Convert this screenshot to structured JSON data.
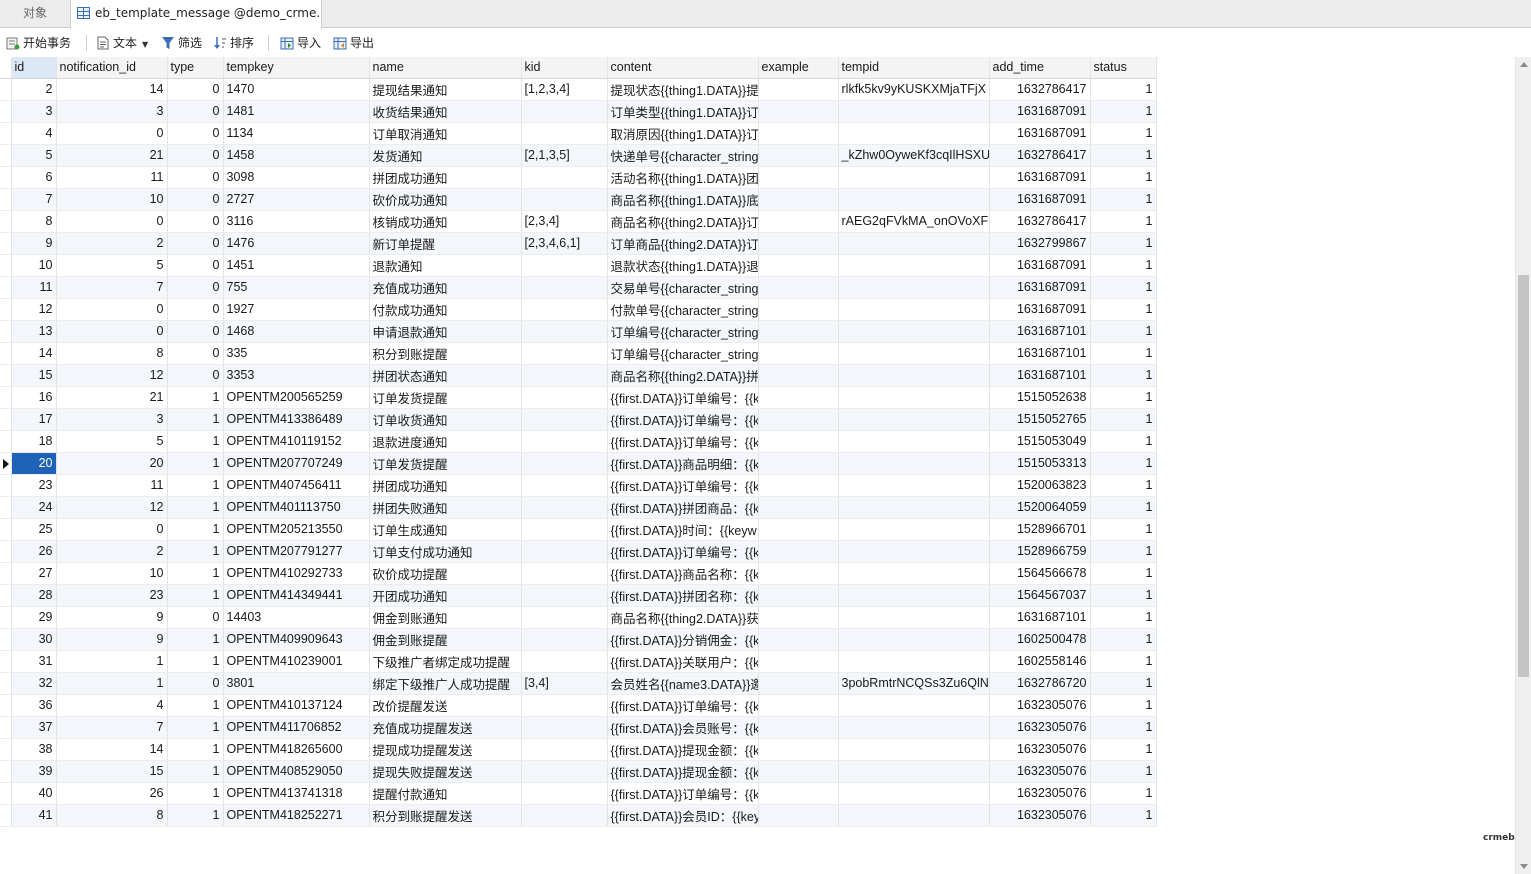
{
  "tabs": {
    "objects_label": "对象",
    "active_label": "eb_template_message @demo_crme..."
  },
  "toolbar": {
    "begin_transaction": "开始事务",
    "text": "文本",
    "filter": "筛选",
    "sort": "排序",
    "import": "导入",
    "export": "导出"
  },
  "columns": [
    "id",
    "notification_id",
    "type",
    "tempkey",
    "name",
    "kid",
    "content",
    "example",
    "tempid",
    "add_time",
    "status"
  ],
  "rows": [
    [
      "2",
      "14",
      "0",
      "1470",
      "提现结果通知",
      "[1,2,3,4]",
      "提现状态{{thing1.DATA}}提",
      "",
      "rlkfk5kv9yKUSKXMjaTFjX",
      "1632786417",
      "1"
    ],
    [
      "3",
      "3",
      "0",
      "1481",
      "收货结果通知",
      "",
      "订单类型{{thing1.DATA}}订",
      "",
      "",
      "1631687091",
      "1"
    ],
    [
      "4",
      "0",
      "0",
      "1134",
      "订单取消通知",
      "",
      "取消原因{{thing1.DATA}}订",
      "",
      "",
      "1631687091",
      "1"
    ],
    [
      "5",
      "21",
      "0",
      "1458",
      "发货通知",
      "[2,1,3,5]",
      "快递单号{{character_string",
      "",
      "_kZhw0OyweKf3cqIlHSXU",
      "1632786417",
      "1"
    ],
    [
      "6",
      "11",
      "0",
      "3098",
      "拼团成功通知",
      "",
      "活动名称{{thing1.DATA}}团",
      "",
      "",
      "1631687091",
      "1"
    ],
    [
      "7",
      "10",
      "0",
      "2727",
      "砍价成功通知",
      "",
      "商品名称{{thing1.DATA}}底",
      "",
      "",
      "1631687091",
      "1"
    ],
    [
      "8",
      "0",
      "0",
      "3116",
      " 核销成功通知",
      "[2,3,4]",
      "商品名称{{thing2.DATA}}订",
      "",
      "rAEG2qFVkMA_onOVoXFi",
      "1632786417",
      "1"
    ],
    [
      "9",
      "2",
      "0",
      "1476",
      " 新订单提醒",
      "[2,3,4,6,1]",
      "订单商品{{thing2.DATA}}订",
      "",
      "",
      "1632799867",
      "1"
    ],
    [
      "10",
      "5",
      "0",
      "1451",
      " 退款通知",
      "",
      "退款状态{{thing1.DATA}}退",
      "",
      "",
      "1631687091",
      "1"
    ],
    [
      "11",
      "7",
      "0",
      "755",
      " 充值成功通知",
      "",
      "交易单号{{character_string",
      "",
      "",
      "1631687091",
      "1"
    ],
    [
      "12",
      "0",
      "0",
      "1927",
      "付款成功通知",
      "",
      "付款单号{{character_string",
      "",
      "",
      "1631687091",
      "1"
    ],
    [
      "13",
      "0",
      "0",
      "1468",
      "申请退款通知",
      "",
      "订单编号{{character_string",
      "",
      "",
      "1631687101",
      "1"
    ],
    [
      "14",
      "8",
      "0",
      "335",
      "积分到账提醒",
      "",
      "订单编号{{character_string",
      "",
      "",
      "1631687101",
      "1"
    ],
    [
      "15",
      "12",
      "0",
      "3353",
      "拼团状态通知",
      "",
      "商品名称{{thing2.DATA}}拼",
      "",
      "",
      "1631687101",
      "1"
    ],
    [
      "16",
      "21",
      "1",
      "OPENTM200565259",
      "订单发货提醒",
      "",
      "{{first.DATA}}订单编号：{{k",
      "",
      "",
      "1515052638",
      "1"
    ],
    [
      "17",
      "3",
      "1",
      "OPENTM413386489",
      "订单收货通知",
      "",
      "{{first.DATA}}订单编号：{{k",
      "",
      "",
      "1515052765",
      "1"
    ],
    [
      "18",
      "5",
      "1",
      "OPENTM410119152",
      "退款进度通知",
      "",
      "{{first.DATA}}订单编号：{{k",
      "",
      "",
      "1515053049",
      "1"
    ],
    [
      "20",
      "20",
      "1",
      "OPENTM207707249",
      "订单发货提醒",
      "",
      "{{first.DATA}}商品明细：{{k",
      "",
      "",
      "1515053313",
      "1"
    ],
    [
      "23",
      "11",
      "1",
      "OPENTM407456411",
      "拼团成功通知",
      "",
      "{{first.DATA}}订单编号：{{k",
      "",
      "",
      "1520063823",
      "1"
    ],
    [
      "24",
      "12",
      "1",
      "OPENTM401113750",
      "拼团失败通知",
      "",
      "{{first.DATA}}拼团商品：{{k",
      "",
      "",
      "1520064059",
      "1"
    ],
    [
      "25",
      "0",
      "1",
      "OPENTM205213550",
      "订单生成通知",
      "",
      "{{first.DATA}}时间：{{keyw",
      "",
      "",
      "1528966701",
      "1"
    ],
    [
      "26",
      "2",
      "1",
      "OPENTM207791277",
      "订单支付成功通知",
      "",
      "{{first.DATA}}订单编号：{{k",
      "",
      "",
      "1528966759",
      "1"
    ],
    [
      "27",
      "10",
      "1",
      "OPENTM410292733",
      "砍价成功提醒",
      "",
      "{{first.DATA}}商品名称：{{k",
      "",
      "",
      "1564566678",
      "1"
    ],
    [
      "28",
      "23",
      "1",
      "OPENTM414349441",
      "开团成功通知",
      "",
      "{{first.DATA}}拼团名称：{{k",
      "",
      "",
      "1564567037",
      "1"
    ],
    [
      "29",
      "9",
      "0",
      "14403",
      "佣金到账通知",
      "",
      "商品名称{{thing2.DATA}}获",
      "",
      "",
      "1631687101",
      "1"
    ],
    [
      "30",
      "9",
      "1",
      "OPENTM409909643",
      "佣金到账提醒",
      "",
      "{{first.DATA}}分销佣金：{{k",
      "",
      "",
      "1602500478",
      "1"
    ],
    [
      "31",
      "1",
      "1",
      "OPENTM410239001",
      "下级推广者绑定成功提醒",
      "",
      "{{first.DATA}}关联用户：{{k",
      "",
      "",
      "1602558146",
      "1"
    ],
    [
      "32",
      "1",
      "0",
      "3801",
      "绑定下级推广人成功提醒",
      "[3,4]",
      "会员姓名{{name3.DATA}}邀",
      "",
      "3pobRmtrNCQSs3Zu6QlN",
      "1632786720",
      "1"
    ],
    [
      "36",
      "4",
      "1",
      "OPENTM410137124",
      "改价提醒发送",
      "",
      "{{first.DATA}}订单编号：{{k",
      "",
      "",
      "1632305076",
      "1"
    ],
    [
      "37",
      "7",
      "1",
      "OPENTM411706852",
      "充值成功提醒发送",
      "",
      "{{first.DATA}}会员账号：{{k",
      "",
      "",
      "1632305076",
      "1"
    ],
    [
      "38",
      "14",
      "1",
      "OPENTM418265600",
      "提现成功提醒发送",
      "",
      "{{first.DATA}}提现金额：{{k",
      "",
      "",
      "1632305076",
      "1"
    ],
    [
      "39",
      "15",
      "1",
      "OPENTM408529050",
      "提现失败提醒发送",
      "",
      "{{first.DATA}}提现金额：{{k",
      "",
      "",
      "1632305076",
      "1"
    ],
    [
      "40",
      "26",
      "1",
      "OPENTM413741318",
      "提醒付款通知",
      "",
      "{{first.DATA}}订单编号：{{k",
      "",
      "",
      "1632305076",
      "1"
    ],
    [
      "41",
      "8",
      "1",
      "OPENTM418252271",
      "积分到账提醒发送",
      "",
      "{{first.DATA}}会员ID：{{key",
      "",
      "",
      "1632305076",
      "1"
    ]
  ],
  "alt_rows": [
    1,
    3,
    5,
    7,
    9,
    11,
    13,
    15,
    17,
    19,
    21,
    23,
    25,
    27,
    29,
    31,
    33
  ],
  "selected_row": 17,
  "watermark": "crmeb",
  "colors": {
    "selection": "#1e63b8",
    "alt_row": "#f3f6fb",
    "accent_icon": "#3b6db3"
  }
}
